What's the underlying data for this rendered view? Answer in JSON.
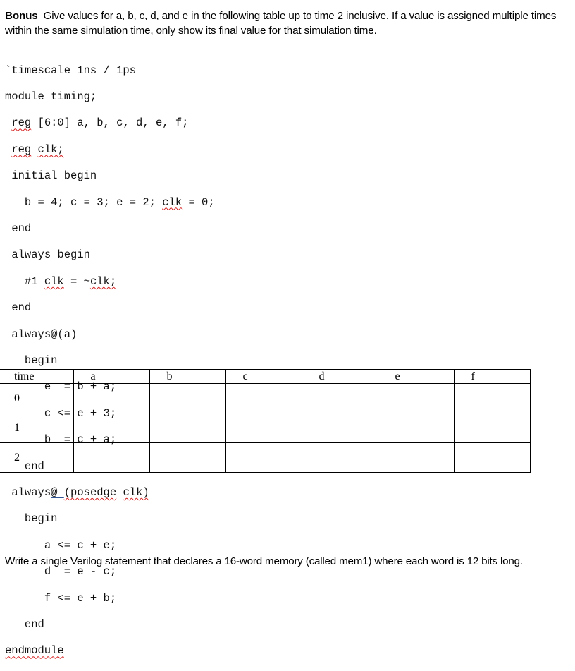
{
  "prompt": {
    "bonus": "Bonus",
    "give": "Give",
    "text": " values for a, b, c, d, and e in the following table up to time 2 inclusive. If a value is assigned multiple times within the same simulation time, only show its final value for that simulation time."
  },
  "code": {
    "l1": "`timescale 1ns / 1ps",
    "l2": "module timing;",
    "l3_kw": "reg",
    "l3_rest": " [6:0] a, b, c, d, e, f;",
    "l4_kw": "reg",
    "l4_sp": " ",
    "l4_clk": "clk;",
    "l5": "initial begin",
    "l6_pre": "b = 4; c = 3; e = 2; ",
    "l6_clk": "clk",
    "l6_post": " = 0;",
    "l7": "end",
    "l8": "always begin",
    "l9_pre": "#1 ",
    "l9_clk": "clk",
    "l9_mid": " = ~",
    "l9_clk2": "clk;",
    "l10": "end",
    "l11": "always@(a)",
    "l12": "begin",
    "l13_u": "e  =",
    "l13_rest": " b + a;",
    "l14": "c <= e + 3;",
    "l15_u": "b  =",
    "l15_rest": " c + a;",
    "l16": "end",
    "l17_pre": "always",
    "l17_at": "@ ",
    "l17_pos": "(posedge",
    "l17_sp": " ",
    "l17_clk": "clk)",
    "l18": "begin",
    "l19": "a <= c + e;",
    "l20": "d  = e - c;",
    "l21": "f <= e + b;",
    "l22": "end",
    "l23": "endmodule"
  },
  "table": {
    "headers": [
      "time",
      "a",
      "b",
      "c",
      "d",
      "e",
      "f"
    ],
    "rows": [
      {
        "time": "0",
        "cells": [
          "",
          "",
          "",
          "",
          "",
          ""
        ]
      },
      {
        "time": "1",
        "cells": [
          "",
          "",
          "",
          "",
          "",
          ""
        ]
      },
      {
        "time": "2",
        "cells": [
          "",
          "",
          "",
          "",
          "",
          ""
        ]
      }
    ]
  },
  "question2": "Write a single Verilog statement that declares a 16-word memory (called mem1) where each word is 12 bits long."
}
